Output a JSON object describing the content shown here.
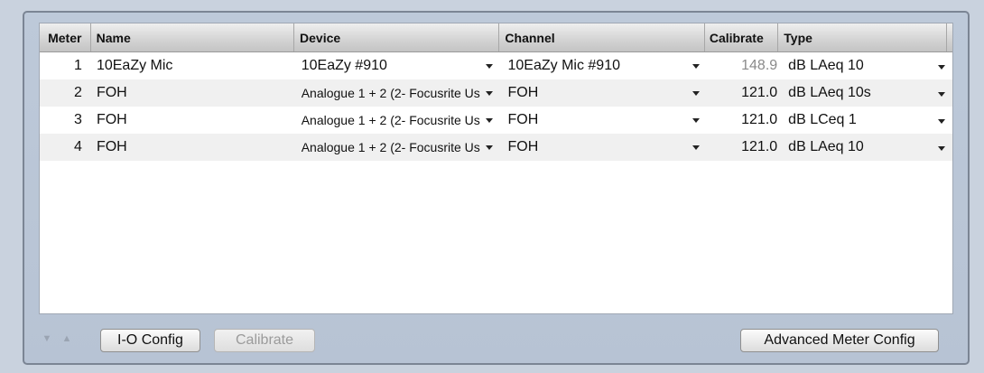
{
  "table": {
    "headers": {
      "meter": "Meter",
      "name": "Name",
      "device": "Device",
      "channel": "Channel",
      "calibrate": "Calibrate",
      "type": "Type"
    },
    "rows": [
      {
        "meter": "1",
        "name": "10EaZy Mic",
        "device": "10EaZy #910",
        "channel": "10EaZy Mic #910",
        "calibrate": "148.9",
        "type": "dB LAeq 10"
      },
      {
        "meter": "2",
        "name": "FOH",
        "device": "Analogue 1 + 2 (2- Focusrite Us",
        "channel": "FOH",
        "calibrate": "121.0",
        "type": "dB LAeq 10s"
      },
      {
        "meter": "3",
        "name": "FOH",
        "device": "Analogue 1 + 2 (2- Focusrite Us",
        "channel": "FOH",
        "calibrate": "121.0",
        "type": "dB LCeq 1"
      },
      {
        "meter": "4",
        "name": "FOH",
        "device": "Analogue 1 + 2 (2- Focusrite Us",
        "channel": "FOH",
        "calibrate": "121.0",
        "type": "dB LAeq 10"
      }
    ]
  },
  "toolbar": {
    "move_down_icon": "▼",
    "move_up_icon": "▲",
    "io_config_label": "I-O Config",
    "calibrate_label": "Calibrate",
    "advanced_label": "Advanced Meter Config"
  },
  "colors": {
    "background": "#c9d2de",
    "panel": "#bdc9d9",
    "row_alt": "#f0f0f0",
    "dim_text": "#8a8a8a"
  }
}
